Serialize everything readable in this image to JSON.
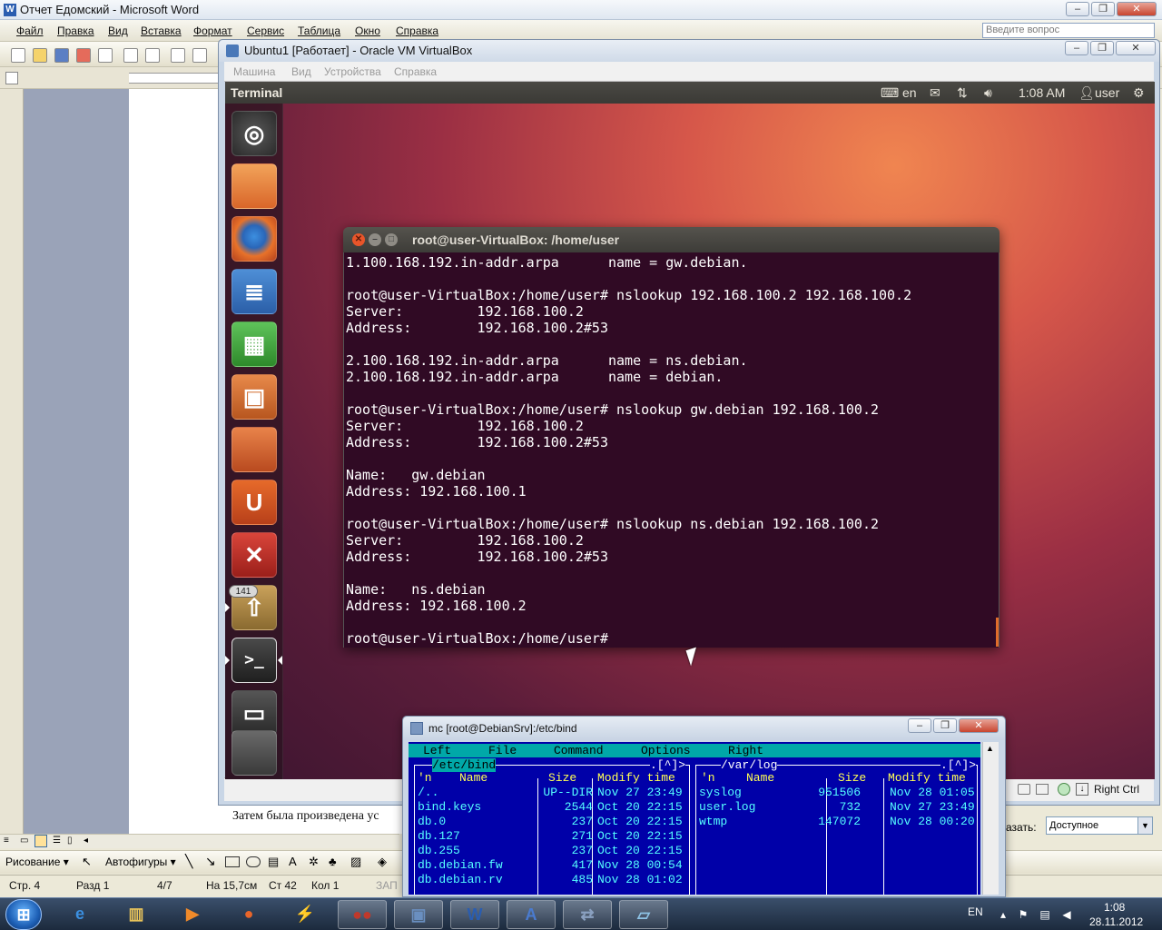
{
  "word": {
    "title": "Отчет Едомский - Microsoft Word",
    "menu": [
      "Файл",
      "Правка",
      "Вид",
      "Вставка",
      "Формат",
      "Сервис",
      "Таблица",
      "Окно",
      "Справка"
    ],
    "ask_placeholder": "Введите вопрос",
    "body_text": "Затем была произведена ус",
    "draw_toolbar": {
      "drawing": "Рисование",
      "autoshapes": "Автофигуры"
    },
    "status": {
      "page": "Стр. 4",
      "section": "Разд 1",
      "pages": "4/7",
      "at": "На 15,7см",
      "line": "Ст 42",
      "col": "Кол 1",
      "rec": "ЗАП"
    },
    "show_label": "азать:",
    "availability_value": "Доступное"
  },
  "vbox": {
    "title": "Ubuntu1 [Работает] - Oracle VM VirtualBox",
    "menu": [
      "Машина",
      "Вид",
      "Устройства",
      "Справка"
    ],
    "host_key": "Right Ctrl"
  },
  "ubuntu": {
    "panel_title": "Terminal",
    "keyboard_layout": "en",
    "clock": "1:08 AM",
    "user": "user",
    "launcher": [
      {
        "name": "dash-icon",
        "glyph": "◎"
      },
      {
        "name": "files-icon",
        "glyph": ""
      },
      {
        "name": "firefox-icon",
        "glyph": ""
      },
      {
        "name": "writer-icon",
        "glyph": "≣"
      },
      {
        "name": "calc-icon",
        "glyph": "▦"
      },
      {
        "name": "impress-icon",
        "glyph": "▣"
      },
      {
        "name": "software-center-icon",
        "glyph": ""
      },
      {
        "name": "ubuntu-one-icon",
        "glyph": "U"
      },
      {
        "name": "system-settings-icon",
        "glyph": "✕"
      },
      {
        "name": "update-manager-icon",
        "glyph": "⇧"
      },
      {
        "name": "terminal-icon",
        "glyph": ">_"
      },
      {
        "name": "workspace-switcher-icon",
        "glyph": "▭"
      },
      {
        "name": "trash-icon",
        "glyph": ""
      }
    ],
    "updates_badge": "141"
  },
  "terminal": {
    "title": "root@user-VirtualBox: /home/user",
    "lines": [
      "1.100.168.192.in-addr.arpa      name = gw.debian.",
      "",
      "root@user-VirtualBox:/home/user# nslookup 192.168.100.2 192.168.100.2",
      "Server:         192.168.100.2",
      "Address:        192.168.100.2#53",
      "",
      "2.100.168.192.in-addr.arpa      name = ns.debian.",
      "2.100.168.192.in-addr.arpa      name = debian.",
      "",
      "root@user-VirtualBox:/home/user# nslookup gw.debian 192.168.100.2",
      "Server:         192.168.100.2",
      "Address:        192.168.100.2#53",
      "",
      "Name:   gw.debian",
      "Address: 192.168.100.1",
      "",
      "root@user-VirtualBox:/home/user# nslookup ns.debian 192.168.100.2",
      "Server:         192.168.100.2",
      "Address:        192.168.100.2#53",
      "",
      "Name:   ns.debian",
      "Address: 192.168.100.2",
      "",
      "root@user-VirtualBox:/home/user# "
    ]
  },
  "mc": {
    "title": "mc [root@DebianSrv]:/etc/bind",
    "menu": [
      "Left",
      "File",
      "Command",
      "Options",
      "Right"
    ],
    "left_panel": {
      "path": "/etc/bind",
      "header": {
        "n": "'n",
        "name": "Name",
        "size": "Size",
        "time": "Modify time"
      },
      "rows": [
        {
          "name": "/..",
          "size": "UP--DIR",
          "time": "Nov 27 23:49"
        },
        {
          "name": "bind.keys",
          "size": "2544",
          "time": "Oct 20 22:15"
        },
        {
          "name": "db.0",
          "size": "237",
          "time": "Oct 20 22:15"
        },
        {
          "name": "db.127",
          "size": "271",
          "time": "Oct 20 22:15"
        },
        {
          "name": "db.255",
          "size": "237",
          "time": "Oct 20 22:15"
        },
        {
          "name": "db.debian.fw",
          "size": "417",
          "time": "Nov 28 00:54"
        },
        {
          "name": "db.debian.rv",
          "size": "485",
          "time": "Nov 28 01:02"
        }
      ]
    },
    "right_panel": {
      "path": "/var/log",
      "header": {
        "n": "'n",
        "name": "Name",
        "size": "Size",
        "time": "Modify time"
      },
      "rows": [
        {
          "name": "syslog",
          "size": "951506",
          "time": "Nov 28 01:05"
        },
        {
          "name": "user.log",
          "size": "732",
          "time": "Nov 27 23:49"
        },
        {
          "name": "wtmp",
          "size": "147072",
          "time": "Nov 28 00:20"
        }
      ]
    },
    "corner_marker": ".[^]>"
  },
  "taskbar": {
    "start_glyph": "⊞",
    "language": "EN",
    "time": "1:08",
    "date": "28.11.2012",
    "buttons": [
      {
        "name": "ie-taskbar-button",
        "glyph": "e",
        "color": "#3b8fe0"
      },
      {
        "name": "explorer-taskbar-button",
        "glyph": "▥",
        "color": "#e9c45a"
      },
      {
        "name": "media-player-taskbar-button",
        "glyph": "▶",
        "color": "#f08a2a"
      },
      {
        "name": "firefox-taskbar-button",
        "glyph": "●",
        "color": "#e8652a"
      },
      {
        "name": "flash-taskbar-button",
        "glyph": "⚡",
        "color": "#2f7fe0"
      },
      {
        "name": "app-taskbar-button",
        "glyph": "●●",
        "color": "#c0392b"
      },
      {
        "name": "virtualbox-taskbar-button",
        "glyph": "▣",
        "color": "#6a8fc0"
      },
      {
        "name": "word-taskbar-button",
        "glyph": "W",
        "color": "#2a5db0"
      },
      {
        "name": "wordpad-taskbar-button",
        "glyph": "A",
        "color": "#4a7bd0"
      },
      {
        "name": "putty-taskbar-button",
        "glyph": "⇄",
        "color": "#8aa0c0"
      },
      {
        "name": "notepad-taskbar-button",
        "glyph": "▱",
        "color": "#8ec3e6"
      }
    ]
  }
}
